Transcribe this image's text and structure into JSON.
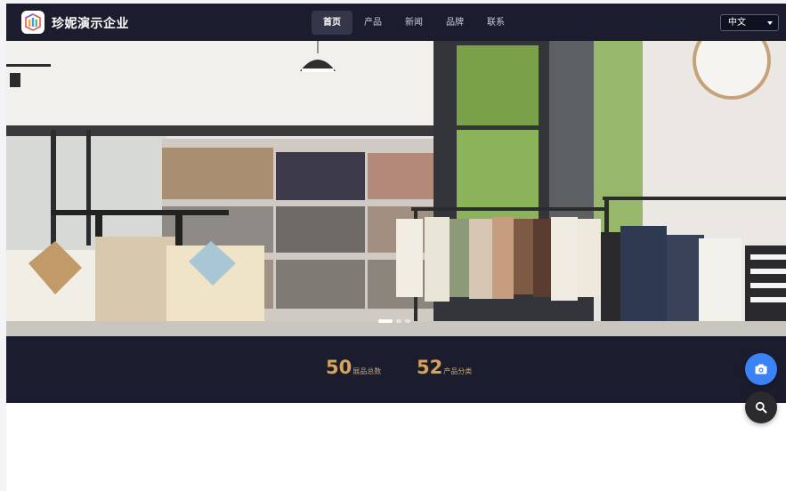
{
  "header": {
    "brand_name": "珍妮演示企业",
    "nav": [
      {
        "label": "首页",
        "active": true
      },
      {
        "label": "产品",
        "active": false
      },
      {
        "label": "新闻",
        "active": false
      },
      {
        "label": "品牌",
        "active": false
      },
      {
        "label": "联系",
        "active": false
      }
    ],
    "language": "中文"
  },
  "hero": {
    "slide_count": 3,
    "active_slide": 1
  },
  "stats": [
    {
      "number": "50",
      "label": "展品总数"
    },
    {
      "number": "52",
      "label": "产品分类"
    }
  ],
  "floating_buttons": {
    "camera_icon": "camera-icon",
    "search_icon": "search-icon",
    "camera_color": "#3b82f6",
    "search_color": "#2b2b2f"
  },
  "colors": {
    "header_bg": "#1b1c2e",
    "accent_gold": "#d6a35a"
  }
}
